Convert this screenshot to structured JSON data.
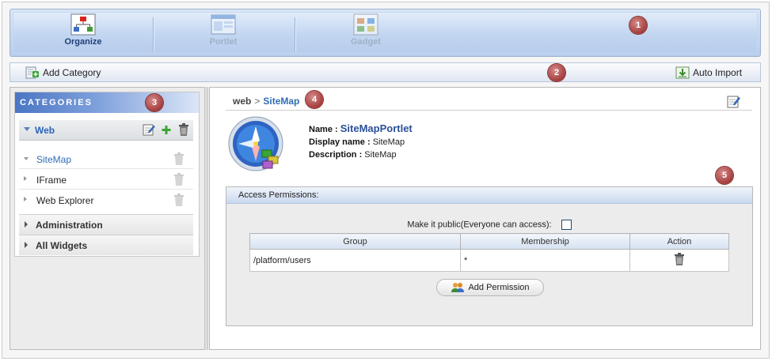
{
  "appbar": {
    "apps": [
      {
        "label": "Organize",
        "icon": "organize-hierarchy-icon",
        "active": true
      },
      {
        "label": "Portlet",
        "icon": "portlet-window-icon",
        "active": false
      },
      {
        "label": "Gadget",
        "icon": "gadget-grid-icon",
        "active": false
      }
    ]
  },
  "badges": [
    "1",
    "2",
    "3",
    "4",
    "5"
  ],
  "toolbar": {
    "add_category": "Add Category",
    "auto_import": "Auto Import"
  },
  "categories": {
    "header": "CATEGORIES",
    "web": {
      "label": "Web",
      "items": [
        {
          "label": "SiteMap",
          "active": true
        },
        {
          "label": "IFrame",
          "active": false
        },
        {
          "label": "Web Explorer",
          "active": false
        }
      ]
    },
    "groups": [
      {
        "label": "Administration"
      },
      {
        "label": "All Widgets"
      }
    ]
  },
  "detail": {
    "breadcrumb": {
      "root": "web",
      "separator": ">",
      "current": "SiteMap"
    },
    "name_label": "Name :",
    "name_value": "SiteMapPortlet",
    "display_label": "Display name :",
    "display_value": "SiteMap",
    "desc_label": "Description :",
    "desc_value": "SiteMap"
  },
  "access": {
    "title": "Access Permissions:",
    "public_label": "Make it public(Everyone can access):",
    "public_checked": false,
    "columns": [
      "Group",
      "Membership",
      "Action"
    ],
    "rows": [
      {
        "group": "/platform/users",
        "membership": "*"
      }
    ],
    "add_button": "Add Permission"
  },
  "colors": {
    "accent": "#2f6db5",
    "badge": "#a43d3d",
    "appbar": "#b7cdec"
  }
}
